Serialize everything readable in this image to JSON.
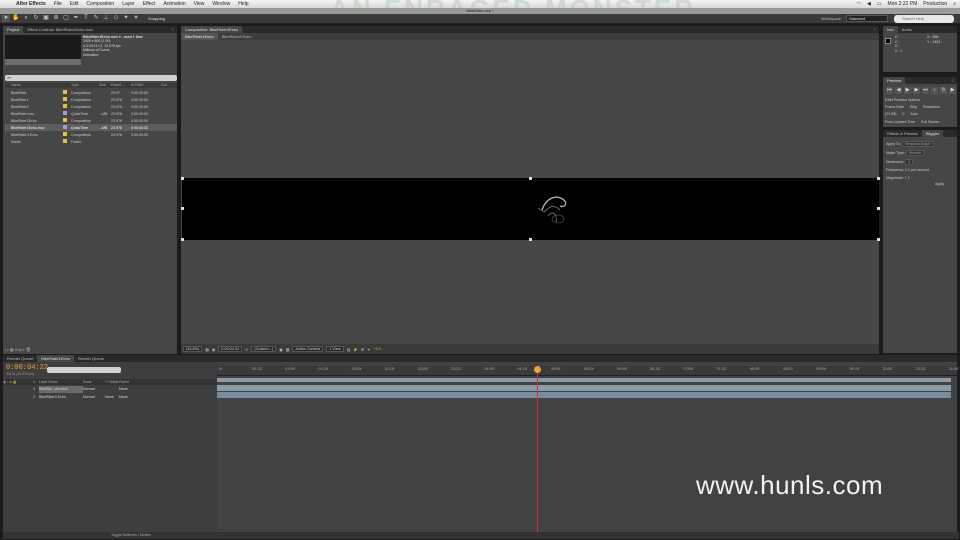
{
  "menubar": {
    "app": "After Effects",
    "items": [
      "File",
      "Edit",
      "Composition",
      "Layer",
      "Effect",
      "Animation",
      "View",
      "Window",
      "Help"
    ],
    "clock": "Mon 2:22 PM",
    "user": "Production",
    "bg_title": "AN ENRAGED MONSTER"
  },
  "window": {
    "title": "BikeRider.aep *"
  },
  "toolbar": {
    "snapping": "Snapping",
    "workspace_label": "Workspace:",
    "workspace_value": "Standard",
    "help_placeholder": "Search Help"
  },
  "project": {
    "tabs": [
      "Project",
      "Effect Controls: BikeRider1Echo.mov"
    ],
    "selected_name": "BikeRider1Echo.mov ▾ , used 1 time",
    "selected_info": [
      "1920 x 800 (1.00)",
      "Δ 0:00:11:07, 23.976 fps",
      "Millions of Colors",
      "Animation"
    ],
    "search_placeholder": "",
    "columns": [
      "Name",
      "",
      "Type",
      "Size",
      "Frame ...",
      "In Point",
      "Out"
    ],
    "rows": [
      {
        "name": "BikeRider",
        "label": "#e6c23c",
        "type": "Composition",
        "size": "",
        "fr": "29.97",
        "in": "0:00:00:00",
        "sel": false
      },
      {
        "name": "BikeRider1",
        "label": "#e6c23c",
        "type": "Composition",
        "size": "",
        "fr": "23.976",
        "in": "0:00:00:00",
        "sel": false
      },
      {
        "name": "BikeRider3",
        "label": "#e6c23c",
        "type": "Composition",
        "size": "",
        "fr": "23.976",
        "in": "0:00:00:00",
        "sel": false
      },
      {
        "name": "BikeRider.mov",
        "label": "#a0a0d0",
        "type": "QuickTime",
        "size": "...MB",
        "fr": "23.976",
        "in": "0:00:00:00",
        "sel": false
      },
      {
        "name": "BikeRider1Echo",
        "label": "#e6c23c",
        "type": "Composition",
        "size": "",
        "fr": "23.976",
        "in": "0:00:00:00",
        "sel": false
      },
      {
        "name": "BikeRider1Echo.mov",
        "label": "#a0a0d0",
        "type": "QuickTime",
        "size": "...MB",
        "fr": "23.976",
        "in": "0:00:00:00",
        "sel": true
      },
      {
        "name": "BikeRider3 Echo",
        "label": "#e6c23c",
        "type": "Composition",
        "size": "",
        "fr": "23.976",
        "in": "0:00:00:00",
        "sel": false
      },
      {
        "name": "Solids",
        "label": "#e6c23c",
        "type": "Folder",
        "size": "",
        "fr": "",
        "in": "",
        "sel": false
      }
    ],
    "footer": "8 bpc"
  },
  "comp": {
    "tab": "Composition: BikeRider1Echo",
    "subtabs": [
      "BikeRider1Echo",
      "BikeRider3 Echo"
    ],
    "controls": {
      "zoom": "(15.8%)",
      "timecode": "0:00:04:22",
      "resolution": "(Custom...)",
      "camera": "Active Camera",
      "views": "1 View",
      "exposure": "+0.0"
    }
  },
  "info": {
    "tabs": [
      "Info",
      "Audio"
    ],
    "rgb": [
      "R :",
      "G :",
      "B :",
      "A : 0"
    ],
    "coords": [
      "X : 266",
      "Y : 2424"
    ]
  },
  "preview": {
    "tab": "Preview",
    "options": "RAM Preview Options",
    "cols": [
      "Frame Rate",
      "Skip",
      "Resolution"
    ],
    "values": [
      "(23.98)",
      "0",
      "Auto"
    ],
    "from_current": "From Current Time",
    "full_screen": "Full Screen"
  },
  "effects": {
    "tabs": [
      "Effects & Presets",
      "Wiggler"
    ],
    "apply_to_label": "Apply To:",
    "apply_to_value": "Temporal Graph",
    "noise_label": "Noise Type:",
    "noise_value": "Smooth",
    "dimension_label": "Dimension:",
    "dimension_value": "X",
    "frequency_label": "Frequency:",
    "frequency_value": "5.0",
    "frequency_unit": "per second",
    "magnitude_label": "Magnitude:",
    "magnitude_value": "1.0",
    "apply_button": "Apply"
  },
  "timeline": {
    "tabs": [
      "Render Queue",
      "BikeRider1Echo",
      "Render Queue"
    ],
    "timecode": "0:00:04:22",
    "frameinfo": "00118 (23.976 fps)",
    "columns": [
      "#",
      "Layer Name",
      "Mode",
      "T TrkMat",
      "Parent"
    ],
    "layers": [
      {
        "num": "1",
        "name": "BikeRid...cho.mov",
        "mode": "Normal",
        "trk": "",
        "parent": "None",
        "sel": true
      },
      {
        "num": "2",
        "name": "BikeRider3 Echo",
        "mode": "Normal",
        "trk": "None",
        "parent": "None",
        "sel": false
      }
    ],
    "ticks": [
      "0f",
      "00:12f",
      "01:00f",
      "01:12f",
      "02:00f",
      "02:12f",
      "03:00f",
      "03:12f",
      "04:00f",
      "04:12f",
      "05:00f",
      "05:12f",
      "06:00f",
      "06:12f",
      "07:00f",
      "07:12f",
      "08:00f",
      "08:12f",
      "09:00f",
      "09:12f",
      "10:00f",
      "10:12f",
      "11:00f"
    ],
    "toggle_label": "Toggle Switches / Modes"
  },
  "watermark": "www.hunls.com",
  "colors": {
    "accent_orange": "#f0a23a",
    "playhead_red": "#d03030"
  }
}
